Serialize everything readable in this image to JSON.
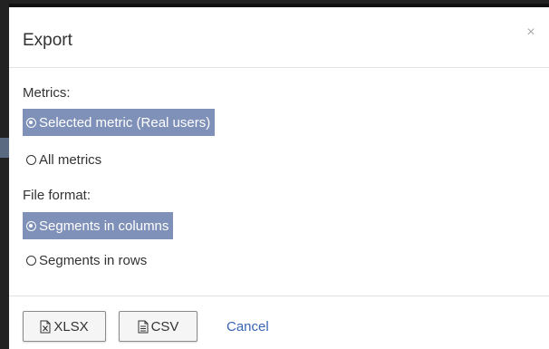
{
  "dialog": {
    "title": "Export",
    "close_glyph": "×",
    "metrics": {
      "label": "Metrics:",
      "options": [
        {
          "label": "Selected metric (Real users)",
          "selected": true
        },
        {
          "label": "All metrics",
          "selected": false
        }
      ]
    },
    "file_format": {
      "label": "File format:",
      "options": [
        {
          "label": "Segments in columns",
          "selected": true
        },
        {
          "label": "Segments in rows",
          "selected": false
        }
      ]
    },
    "buttons": {
      "xlsx_label": "XLSX",
      "csv_label": "CSV",
      "cancel_label": "Cancel"
    }
  },
  "colors": {
    "selected_bg": "#7f91b8",
    "link": "#3a64b4"
  },
  "icons": {
    "close": "close-icon",
    "xlsx": "excel-file-icon",
    "csv": "text-file-icon",
    "radio": "radio-icon"
  }
}
